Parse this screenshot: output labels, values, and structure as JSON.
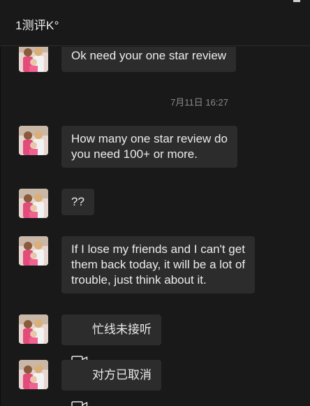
{
  "header": {
    "title": "1测评K°"
  },
  "messages": [
    {
      "type": "text",
      "text": "Ok need your one star review"
    },
    {
      "type": "timestamp",
      "text": "7月11日 16:27"
    },
    {
      "type": "text",
      "text": "How many one star review do\nyou need 100+ or more."
    },
    {
      "type": "text",
      "text": "??"
    },
    {
      "type": "text",
      "text": "If I lose my friends and I can't get\nthem back today, it will be a lot of\ntrouble, just think about it."
    },
    {
      "type": "call",
      "icon": "video-call-icon",
      "text": "忙线未接听"
    },
    {
      "type": "call",
      "icon": "video-call-icon",
      "text": "对方已取消"
    }
  ],
  "colors": {
    "background": "#191919",
    "bubble": "#2c2c2c",
    "text": "#ececec",
    "timestamp": "#8a8a8a"
  }
}
